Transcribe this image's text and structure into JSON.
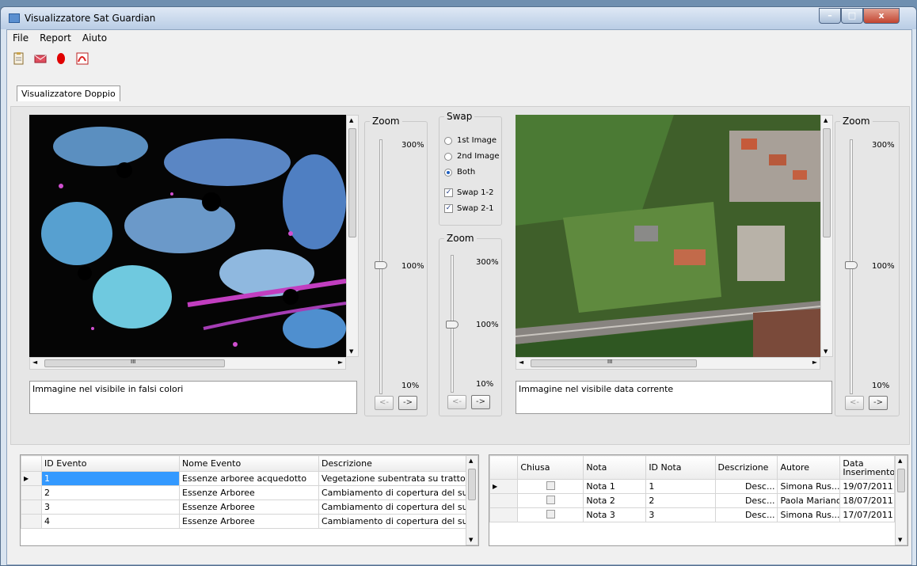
{
  "window": {
    "title": "Visualizzatore Sat Guardian",
    "minimize": "–",
    "maximize": "□",
    "close": "x"
  },
  "menu": [
    "File",
    "Report",
    "Aiuto"
  ],
  "toolbar": {
    "icons": [
      "clipboard-icon",
      "mail-icon",
      "record-icon",
      "pdf-icon"
    ]
  },
  "tab": {
    "label": "Visualizzatore Doppio"
  },
  "left_view": {
    "caption": "Immagine nel visibile in falsi colori",
    "zoom": {
      "title": "Zoom",
      "max": "300%",
      "mid": "100%",
      "min": "10%",
      "value": "100%"
    }
  },
  "right_view": {
    "caption": "Immagine nel visibile data corrente",
    "zoom": {
      "title": "Zoom",
      "max": "300%",
      "mid": "100%",
      "min": "10%",
      "value": "100%"
    }
  },
  "swap": {
    "title": "Swap",
    "radios": [
      {
        "label": "1st Image",
        "checked": false
      },
      {
        "label": "2nd Image",
        "checked": false
      },
      {
        "label": "Both",
        "checked": true
      }
    ],
    "checks": [
      {
        "label": "Swap 1-2",
        "checked": true
      },
      {
        "label": "Swap 2-1",
        "checked": true
      }
    ]
  },
  "center_zoom": {
    "title": "Zoom",
    "max": "300%",
    "mid": "100%",
    "min": "10%"
  },
  "nav_buttons": {
    "prev": "<-",
    "next": "->"
  },
  "scroll": {
    "up": "▲",
    "down": "▼",
    "left": "◄",
    "right": "►",
    "grip": "III"
  },
  "events_table": {
    "headers": [
      "ID Evento",
      "Nome Evento",
      "Descrizione"
    ],
    "current_row_marker": "▶",
    "rows": [
      [
        "1",
        "Essenze arboree acquedotto",
        "Vegetazione subentrata su tratto ..."
      ],
      [
        "2",
        "Essenze Arboree",
        "Cambiamento di copertura del su..."
      ],
      [
        "3",
        "Essenze Arboree",
        "Cambiamento di copertura del su..."
      ],
      [
        "4",
        "Essenze Arboree",
        "Cambiamento di copertura del su..."
      ]
    ]
  },
  "notes_table": {
    "headers": [
      "Chiusa",
      "Nota",
      "ID Nota",
      "Descrizione",
      "Autore",
      "Data Inserimento"
    ],
    "current_row_marker": "▶",
    "rows": [
      [
        "",
        "Nota 1",
        "1",
        "Desc...",
        "Simona Rus...",
        "19/07/2011"
      ],
      [
        "",
        "Nota 2",
        "2",
        "Desc...",
        "Paola Mariano",
        "18/07/2011"
      ],
      [
        "",
        "Nota 3",
        "3",
        "Desc...",
        "Simona Rus...",
        "17/07/2011"
      ]
    ]
  }
}
